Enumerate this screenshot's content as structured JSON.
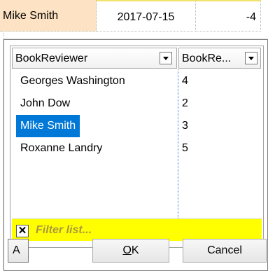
{
  "background_row": {
    "name": "Mike Smith",
    "date": "2017-07-15",
    "value": "-4"
  },
  "popup": {
    "columns": [
      {
        "label": "BookReviewer"
      },
      {
        "label": "BookRe..."
      }
    ],
    "rows": [
      {
        "reviewer": "Georges Washington",
        "value": "4"
      },
      {
        "reviewer": "John Dow",
        "value": "2"
      },
      {
        "reviewer": "Mike Smith",
        "value": "3"
      },
      {
        "reviewer": "Roxanne Landry",
        "value": "5"
      }
    ],
    "selected_index": 2,
    "filter": {
      "clear_glyph": "✕",
      "placeholder": "Filter list..."
    },
    "buttons": {
      "a_label": "A",
      "ok_mnemonic": "O",
      "ok_rest": "K",
      "cancel_label": "Cancel"
    }
  },
  "colors": {
    "selection": "#0078d7",
    "filter_bar": "#ffff00",
    "active_cell_bg": "#fde3c3"
  }
}
